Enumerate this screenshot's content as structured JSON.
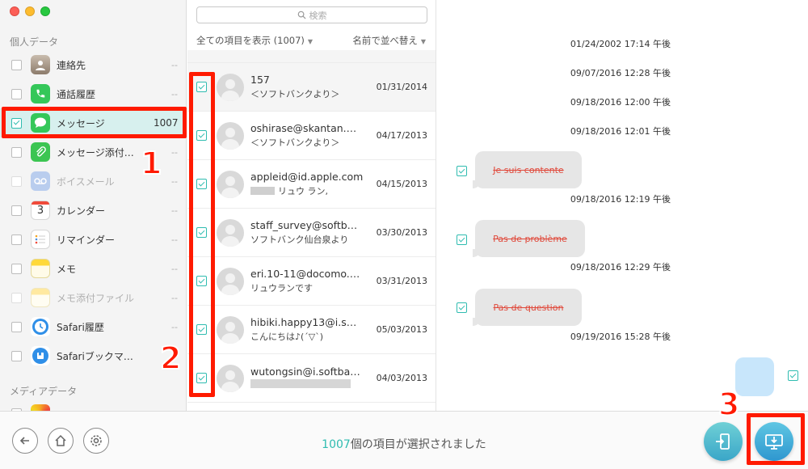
{
  "sidebar": {
    "section_personal": "個人データ",
    "section_media": "メディアデータ",
    "items": [
      {
        "label": "連絡先",
        "count": "--",
        "icon": "contacts-icon",
        "color": "#9a8a7c",
        "checked": false,
        "disabled": false
      },
      {
        "label": "通話履歴",
        "count": "--",
        "icon": "phone-icon",
        "color": "#34c759",
        "checked": false,
        "disabled": false
      },
      {
        "label": "メッセージ",
        "count": "1007",
        "icon": "messages-icon",
        "color": "#34c759",
        "checked": true,
        "disabled": false
      },
      {
        "label": "メッセージ添付…",
        "count": "--",
        "icon": "message-attachment-icon",
        "color": "#3cc552",
        "checked": false,
        "disabled": false
      },
      {
        "label": "ボイスメール",
        "count": "--",
        "icon": "voicemail-icon",
        "color": "#a9c2e9",
        "checked": false,
        "disabled": true
      },
      {
        "label": "カレンダー",
        "count": "--",
        "icon": "calendar-icon",
        "color": "#ffffff",
        "checked": false,
        "disabled": false
      },
      {
        "label": "リマインダー",
        "count": "--",
        "icon": "reminders-icon",
        "color": "#ffffff",
        "checked": false,
        "disabled": false
      },
      {
        "label": "メモ",
        "count": "--",
        "icon": "notes-icon",
        "color": "#ffd93a",
        "checked": false,
        "disabled": false
      },
      {
        "label": "メモ添付ファイル",
        "count": "--",
        "icon": "notes-attachment-icon",
        "color": "#ffe9a0",
        "checked": false,
        "disabled": true
      },
      {
        "label": "Safari履歴",
        "count": "--",
        "icon": "safari-icon",
        "color": "#2f8fe8",
        "checked": false,
        "disabled": false
      },
      {
        "label": "Safariブックマ…",
        "count": "--",
        "icon": "safari-bookmark-icon",
        "color": "#2f8fe8",
        "checked": false,
        "disabled": false
      }
    ],
    "calendar_day": "3"
  },
  "list": {
    "search_placeholder": "検索",
    "filter_label": "全ての項目を表示 (1007)",
    "sort_label": "名前で並べ替え",
    "rows": [
      {
        "name": "157",
        "preview": "＜ソフトバンクより＞",
        "date": "01/31/2014"
      },
      {
        "name": "oshirase@skantan.…",
        "preview": "＜ソフトバンクより＞",
        "date": "04/17/2013"
      },
      {
        "name": "appleid@id.apple.com",
        "preview": "リュウ ラン,",
        "date": "04/15/2013"
      },
      {
        "name": "staff_survey@softb…",
        "preview": "ソフトバンク仙台泉より",
        "date": "03/30/2013"
      },
      {
        "name": "eri.10-11@docomo.…",
        "preview": "リュウランです",
        "date": "03/31/2013"
      },
      {
        "name": "hibiki.happy13@i.s…",
        "preview": "こんにちは♪(´▽`)",
        "date": "05/03/2013"
      },
      {
        "name": "wutongsin@i.softba…",
        "preview": "",
        "date": "04/03/2013"
      }
    ]
  },
  "detail": {
    "timestamps": [
      "01/24/2002 17:14 午後",
      "09/07/2016 12:28 午後",
      "09/18/2016 12:00 午後",
      "09/18/2016 12:01 午後",
      "09/18/2016 12:19 午後",
      "09/18/2016 12:29 午後",
      "09/19/2016 15:28 午後"
    ],
    "bubbles": [
      "Je suis contente",
      "Pas de problème",
      "Pas de question"
    ]
  },
  "bottom": {
    "selected_count": "1007",
    "selected_suffix": "個の項目が選択されました"
  },
  "annotations": [
    "1",
    "2",
    "3"
  ],
  "colors": {
    "accent": "#2fbcb0",
    "highlight": "#ff1a00",
    "strike_text": "#e0483a"
  }
}
